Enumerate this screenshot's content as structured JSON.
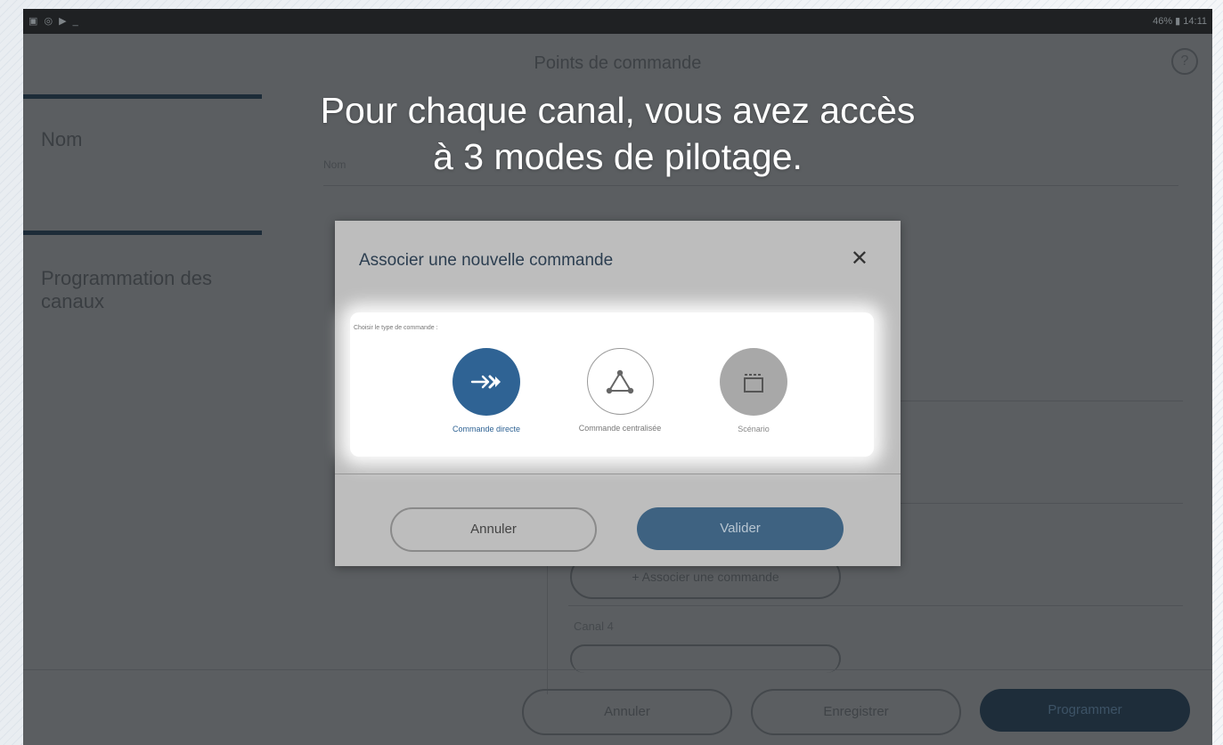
{
  "status_bar": {
    "left_icons": "▣ ◎ ▶ _",
    "right_text": "46% ▮ 14:11"
  },
  "header": {
    "title": "Points de commande",
    "help_icon": "help-circle-icon"
  },
  "overlay_caption": {
    "line1": "Pour chaque canal, vous avez accès",
    "line2": "à 3 modes de pilotage."
  },
  "sidebar": {
    "items": [
      {
        "label": "Nom"
      },
      {
        "label": "Programmation des canaux"
      }
    ]
  },
  "form": {
    "name_field_label": "Nom",
    "associate_button_label": "+  Associer une commande",
    "canal4_label": "Canal 4"
  },
  "footer": {
    "cancel_label": "Annuler",
    "save_label": "Enregistrer",
    "program_label": "Programmer"
  },
  "dialog": {
    "title": "Associer une nouvelle commande",
    "close_icon": "close-icon",
    "choose_label": "Choisir le type de commande :",
    "modes": [
      {
        "label": "Commande directe",
        "icon": "arrow-right-icon",
        "selected": true,
        "color": "#2f6394"
      },
      {
        "label": "Commande centralisée",
        "icon": "network-triangle-icon",
        "selected": false,
        "color": "#ffffff"
      },
      {
        "label": "Scénario",
        "icon": "clapperboard-icon",
        "selected": false,
        "color": "#a8a8a8"
      }
    ],
    "cancel_label": "Annuler",
    "validate_label": "Valider"
  },
  "colors": {
    "accent": "#2f6394",
    "dark_button": "#1e2d3a"
  }
}
